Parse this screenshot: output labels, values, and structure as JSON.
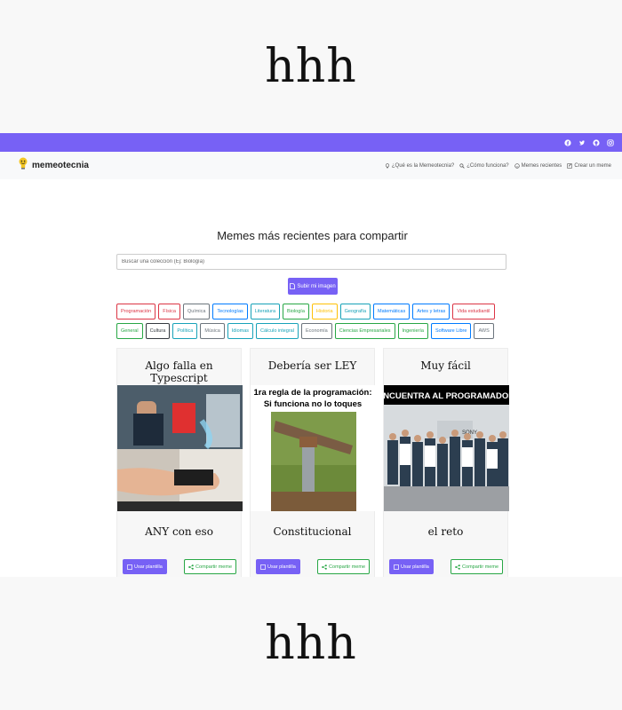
{
  "band_text": "hhh",
  "topbar": {
    "icons": [
      "facebook-icon",
      "twitter-icon",
      "github-icon",
      "instagram-icon"
    ]
  },
  "navbar": {
    "brand": "memeotecnia",
    "links": [
      {
        "label": "¿Qué es la Memeotecnia?",
        "icon": "lightbulb-icon"
      },
      {
        "label": "¿Cómo funciona?",
        "icon": "search-icon"
      },
      {
        "label": "Memes recientes",
        "icon": "smile-icon"
      },
      {
        "label": "Crear un meme",
        "icon": "edit-icon"
      }
    ]
  },
  "main": {
    "heading": "Memes más recientes para compartir",
    "search_placeholder": "Buscar una colección (Ej: Biología)",
    "upload_label": "Subir mi imagen"
  },
  "tags_row1": [
    {
      "label": "Programación",
      "color": "#dc3545"
    },
    {
      "label": "Física",
      "color": "#dc3545"
    },
    {
      "label": "Química",
      "color": "#6c757d"
    },
    {
      "label": "Tecnologías",
      "color": "#007bff"
    },
    {
      "label": "Literatura",
      "color": "#17a2b8"
    },
    {
      "label": "Biología",
      "color": "#28a745"
    },
    {
      "label": "Historia",
      "color": "#ffc107"
    },
    {
      "label": "Geografía",
      "color": "#17a2b8"
    },
    {
      "label": "Matemáticas",
      "color": "#007bff"
    },
    {
      "label": "Artes y letras",
      "color": "#007bff"
    },
    {
      "label": "Vida estudiantil",
      "color": "#dc3545"
    }
  ],
  "tags_row2": [
    {
      "label": "General",
      "color": "#28a745"
    },
    {
      "label": "Cultura",
      "color": "#343a40"
    },
    {
      "label": "Política",
      "color": "#17a2b8"
    },
    {
      "label": "Música",
      "color": "#6c757d"
    },
    {
      "label": "Idiomas",
      "color": "#17a2b8"
    },
    {
      "label": "Cálculo integral",
      "color": "#17a2b8"
    },
    {
      "label": "Economía",
      "color": "#6c757d"
    },
    {
      "label": "Ciencias Empresariales",
      "color": "#28a745"
    },
    {
      "label": "Ingeniería",
      "color": "#28a745"
    },
    {
      "label": "Software Libre",
      "color": "#007bff"
    },
    {
      "label": "AWS",
      "color": "#6c757d"
    }
  ],
  "cards": [
    {
      "title": "Algo falla en Typescript",
      "caption": "ANY con eso",
      "use_label": "Usar plantilla",
      "share_label": "Compartir meme",
      "image_text": [
        "MISSING TYPESCRIPT DEFINITIONS",
        "JS DEVELOPER",
        "FLEX TAPE",
        "<ANY>"
      ]
    },
    {
      "title": "Debería ser LEY",
      "caption": "Constitucional",
      "use_label": "Usar plantilla",
      "share_label": "Compartir meme",
      "image_text": [
        "1ra regla de la programación:",
        "Si funciona no lo toques"
      ]
    },
    {
      "title": "Muy fácil",
      "caption": "el reto",
      "use_label": "Usar plantilla",
      "share_label": "Compartir meme",
      "image_text": [
        "ENCUENTRA AL PROGRAMADOR",
        "SONY"
      ]
    }
  ]
}
